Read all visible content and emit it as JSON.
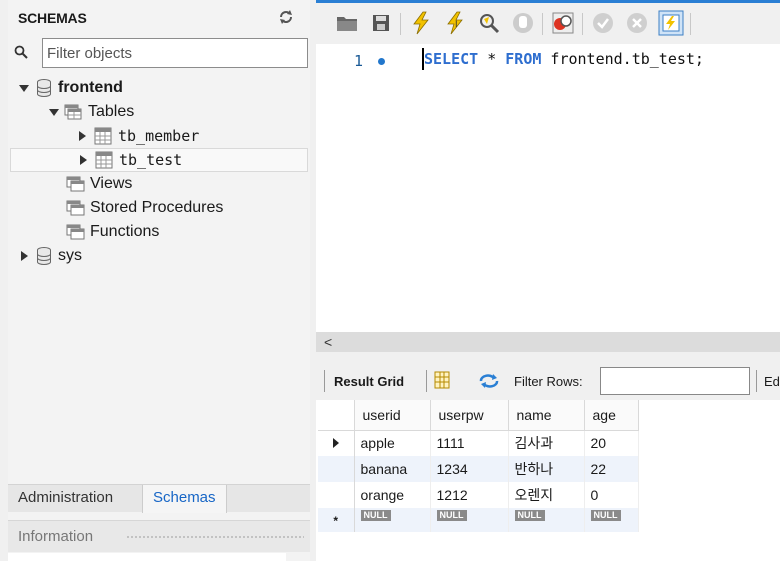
{
  "sidebar": {
    "title": "SCHEMAS",
    "filter_placeholder": "Filter objects",
    "tree": {
      "frontend": "frontend",
      "tables": "Tables",
      "tb_member": "tb_member",
      "tb_test": "tb_test",
      "views": "Views",
      "stored_procedures": "Stored Procedures",
      "functions": "Functions",
      "sys": "sys"
    },
    "tabs": {
      "administration": "Administration",
      "schemas": "Schemas"
    },
    "info_label": "Information"
  },
  "editor": {
    "line_number": "1",
    "sql": {
      "kw1": "SELECT",
      "star": " * ",
      "kw2": "FROM",
      "rest": " frontend.tb_test;"
    }
  },
  "hscroll": {
    "left_arrow": "<"
  },
  "result_toolbar": {
    "result_grid": "Result Grid",
    "filter_rows": "Filter Rows:",
    "edit": "Ed"
  },
  "grid": {
    "columns": [
      "userid",
      "userpw",
      "name",
      "age"
    ],
    "rows": [
      [
        "apple",
        "1111",
        "김사과",
        "20"
      ],
      [
        "banana",
        "1234",
        "반하나",
        "22"
      ],
      [
        "orange",
        "1212",
        "오렌지",
        "0"
      ]
    ],
    "null_label": "NULL",
    "new_row_marker": "*"
  },
  "colors": {
    "keyword": "#2e6ecf",
    "accent": "#2a7fd4",
    "link_tab": "#1766c6"
  }
}
